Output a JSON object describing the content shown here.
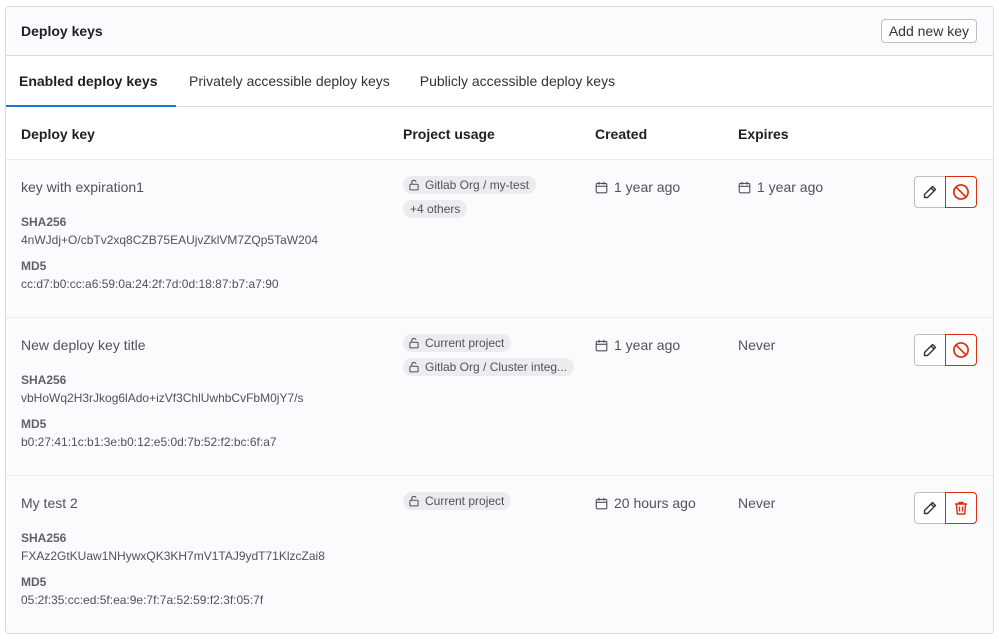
{
  "card": {
    "title": "Deploy keys",
    "add_button": "Add new key"
  },
  "tabs": [
    {
      "label": "Enabled deploy keys",
      "active": true
    },
    {
      "label": "Privately accessible deploy keys",
      "active": false
    },
    {
      "label": "Publicly accessible deploy keys",
      "active": false
    }
  ],
  "columns": {
    "deploy_key": "Deploy key",
    "project_usage": "Project usage",
    "created": "Created",
    "expires": "Expires"
  },
  "keys": [
    {
      "title": "key with expiration1",
      "sha_label": "SHA256",
      "sha": "4nWJdj+O/cbTv2xq8CZB75EAUjvZklVM7ZQp5TaW204",
      "md5_label": "MD5",
      "md5": "cc:d7:b0:cc:a6:59:0a:24:2f:7d:0d:18:87:b7:a7:90",
      "usage": [
        "Gitlab Org / my-test",
        "+4 others"
      ],
      "created": "1 year ago",
      "expires": "1 year ago",
      "action": "revoke"
    },
    {
      "title": "New deploy key title",
      "sha_label": "SHA256",
      "sha": "vbHoWq2H3rJkog6lAdo+izVf3ChlUwhbCvFbM0jY7/s",
      "md5_label": "MD5",
      "md5": "b0:27:41:1c:b1:3e:b0:12:e5:0d:7b:52:f2:bc:6f:a7",
      "usage": [
        "Current project",
        "Gitlab Org / Cluster integ..."
      ],
      "created": "1 year ago",
      "expires": "Never",
      "action": "revoke"
    },
    {
      "title": "My test 2",
      "sha_label": "SHA256",
      "sha": "FXAz2GtKUaw1NHywxQK3KH7mV1TAJ9ydT71KlzcZai8",
      "md5_label": "MD5",
      "md5": "05:2f:35:cc:ed:5f:ea:9e:7f:7a:52:59:f2:3f:05:7f",
      "usage": [
        "Current project"
      ],
      "created": "20 hours ago",
      "expires": "Never",
      "action": "delete"
    }
  ],
  "colors": {
    "accent": "#1f75cb",
    "danger": "#dd2b0e"
  },
  "icons": {
    "lock": "lock-open-icon",
    "calendar": "calendar-icon",
    "edit": "pencil-icon",
    "revoke": "remove-icon",
    "delete": "trash-icon"
  }
}
